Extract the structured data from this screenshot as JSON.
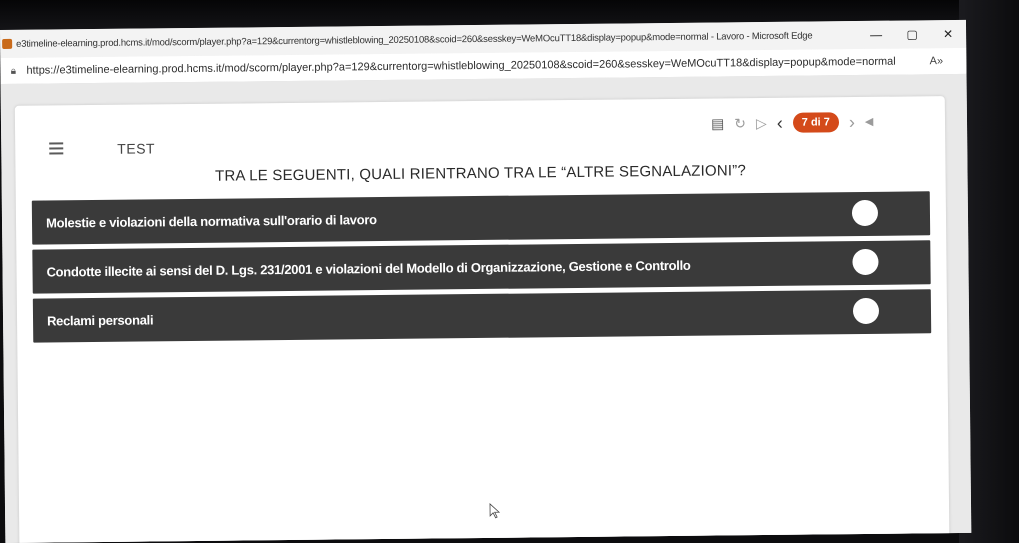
{
  "window": {
    "title": "e3timeline-elearning.prod.hcms.it/mod/scorm/player.php?a=129&currentorg=whistleblowing_20250108&scoid=260&sesskey=WeMOcuTT18&display=popup&mode=normal - Lavoro - Microsoft Edge",
    "controls": {
      "minimize": "—",
      "maximize": "▢",
      "close": "✕"
    }
  },
  "address_bar": {
    "url": "https://e3timeline-elearning.prod.hcms.it/mod/scorm/player.php?a=129&currentorg=whistleblowing_20250108&scoid=260&sesskey=WeMOcuTT18&display=popup&mode=normal",
    "read_aloud_icon": "A»"
  },
  "lesson": {
    "title": "TEST",
    "page_indicator": "7 di 7"
  },
  "question": "TRA LE SEGUENTI, QUALI RIENTRANO TRA LE “ALTRE SEGNALAZIONI”?",
  "options": [
    {
      "label": "Molestie e violazioni della normativa sull'orario di lavoro"
    },
    {
      "label": "Condotte illecite ai sensi del D. Lgs. 231/2001 e violazioni del Modello di Organizzazione, Gestione e Controllo"
    },
    {
      "label": "Reclami personali"
    }
  ],
  "colors": {
    "accent": "#d44a1a",
    "option_bg": "#3a3a3a"
  }
}
